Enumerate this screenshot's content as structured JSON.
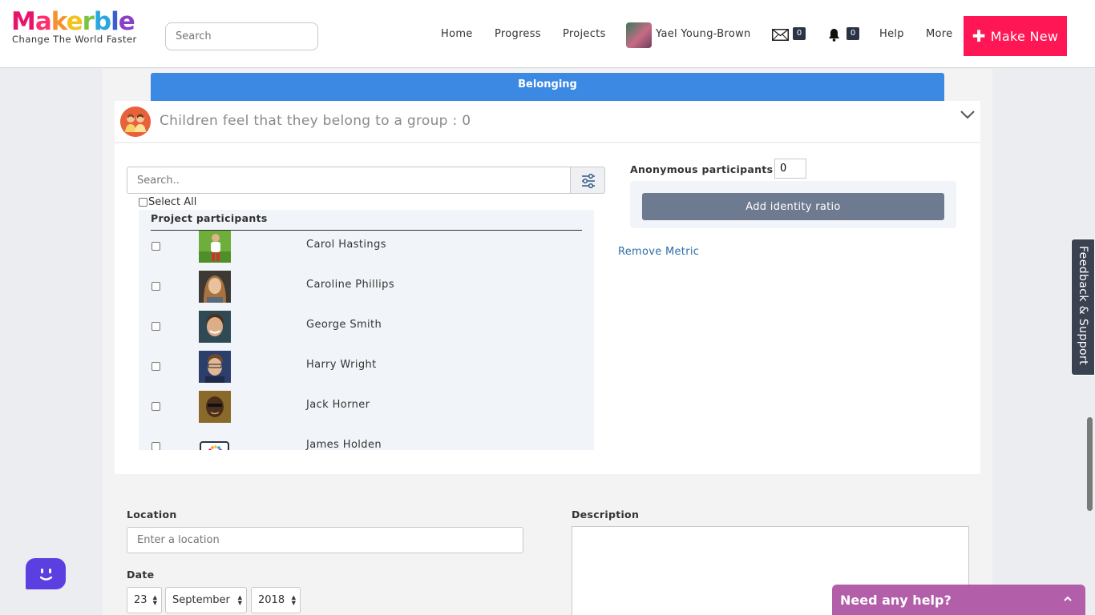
{
  "header": {
    "logo_text": "Makerble",
    "tagline": "Change The World Faster",
    "search_placeholder": "Search",
    "nav": [
      "Home",
      "Progress",
      "Projects"
    ],
    "user_name": "Yael Young-Brown",
    "mail_count": "0",
    "notification_count": "0",
    "help": "Help",
    "more": "More",
    "make_new": "Make New"
  },
  "metric": {
    "section_title": "Belonging",
    "title": "Children feel that they belong to a group : 0"
  },
  "participants": {
    "search_placeholder": "Search..",
    "select_all": "Select All",
    "list_header": "Project participants",
    "people": [
      {
        "name": "Carol Hastings"
      },
      {
        "name": "Caroline Phillips"
      },
      {
        "name": "George Smith"
      },
      {
        "name": "Harry Wright"
      },
      {
        "name": "Jack Horner"
      },
      {
        "name": "James Holden"
      }
    ]
  },
  "anonymous": {
    "label": "Anonymous participants :",
    "value": "0",
    "identity_button": "Add identity ratio",
    "remove_metric": "Remove Metric"
  },
  "form": {
    "location_label": "Location",
    "location_placeholder": "Enter a location",
    "description_label": "Description",
    "date_label": "Date",
    "day": "23",
    "month": "September",
    "year": "2018"
  },
  "widgets": {
    "feedback": "Feedback & Support",
    "help_chat": "Need any help?"
  },
  "colors": {
    "make_new_bg": "#ff1654",
    "belonging_bar": "#3b89e3",
    "identity_button": "#6e7a8f",
    "help_bar": "#b35ea8",
    "bot_widget": "#5b3fe0",
    "link": "#2f6ca8"
  }
}
